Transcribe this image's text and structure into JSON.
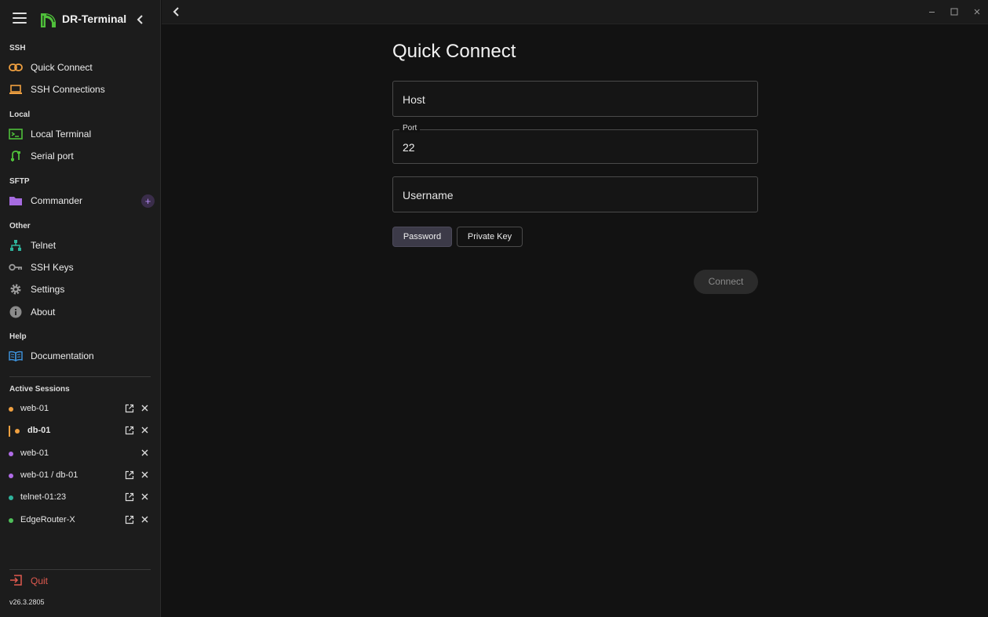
{
  "app": {
    "title": "DR-Terminal",
    "version": "v26.3.2805"
  },
  "sidebar": {
    "sections": {
      "ssh": "SSH",
      "local": "Local",
      "sftp": "SFTP",
      "other": "Other",
      "help": "Help",
      "active_sessions": "Active Sessions"
    },
    "items": {
      "quick_connect": {
        "label": "Quick Connect",
        "icon": "link-icon"
      },
      "ssh_connections": {
        "label": "SSH Connections",
        "icon": "laptop-icon"
      },
      "local_terminal": {
        "label": "Local Terminal",
        "icon": "terminal-icon"
      },
      "serial_port": {
        "label": "Serial port",
        "icon": "serial-cable-icon"
      },
      "commander": {
        "label": "Commander",
        "icon": "folder-icon",
        "add": "+"
      },
      "telnet": {
        "label": "Telnet",
        "icon": "network-icon"
      },
      "ssh_keys": {
        "label": "SSH Keys",
        "icon": "key-icon"
      },
      "settings": {
        "label": "Settings",
        "icon": "gear-icon"
      },
      "about": {
        "label": "About",
        "icon": "info-icon"
      },
      "documentation": {
        "label": "Documentation",
        "icon": "book-icon"
      }
    },
    "sessions": [
      {
        "name": "web-01",
        "color": "#f0a040",
        "openable": true
      },
      {
        "name": "db-01",
        "color": "#f0a040",
        "openable": true,
        "active": true
      },
      {
        "name": "web-01",
        "color": "#b06ce8",
        "openable": false
      },
      {
        "name": "web-01 / db-01",
        "color": "#b06ce8",
        "openable": true
      },
      {
        "name": "telnet-01:23",
        "color": "#2fb39c",
        "openable": true
      },
      {
        "name": "EdgeRouter-X",
        "color": "#4fbf5a",
        "openable": true
      }
    ],
    "quit": "Quit"
  },
  "main": {
    "title": "Quick Connect",
    "host": {
      "placeholder": "Host"
    },
    "port": {
      "label": "Port",
      "value": "22"
    },
    "username": {
      "placeholder": "Username"
    },
    "auth": {
      "password": "Password",
      "private_key": "Private Key",
      "selected": "Password"
    },
    "connect": "Connect"
  },
  "colors": {
    "accent_green": "#4fbf3a",
    "accent_orange": "#f0a040",
    "accent_purple": "#b06ce8",
    "quit_red": "#e05a4f"
  }
}
